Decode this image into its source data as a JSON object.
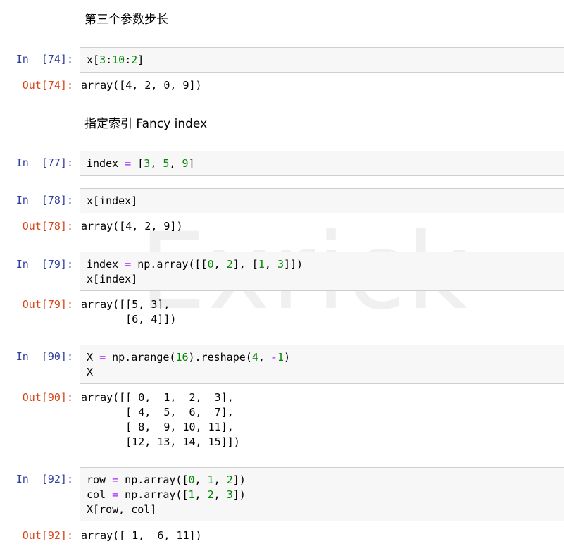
{
  "markdown": {
    "step_heading": "第三个参数步长",
    "fancy_heading": "指定索引 Fancy index"
  },
  "cells": {
    "c74": {
      "in_prompt": "In  [74]:",
      "out_prompt": "Out[74]:",
      "code": "x[3:10:2]",
      "output": "array([4, 2, 0, 9])"
    },
    "c77": {
      "in_prompt": "In  [77]:",
      "code": "index = [3, 5, 9]"
    },
    "c78": {
      "in_prompt": "In  [78]:",
      "out_prompt": "Out[78]:",
      "code": "x[index]",
      "output": "array([4, 2, 9])"
    },
    "c79": {
      "in_prompt": "In  [79]:",
      "out_prompt": "Out[79]:",
      "code": "index = np.array([[0, 2], [1, 3]])\nx[index]",
      "output": "array([[5, 3],\n       [6, 4]])"
    },
    "c90": {
      "in_prompt": "In  [90]:",
      "out_prompt": "Out[90]:",
      "code": "X = np.arange(16).reshape(4, -1)\nX",
      "output": "array([[ 0,  1,  2,  3],\n       [ 4,  5,  6,  7],\n       [ 8,  9, 10, 11],\n       [12, 13, 14, 15]])"
    },
    "c92": {
      "in_prompt": "In  [92]:",
      "out_prompt": "Out[92]:",
      "code": "row = np.array([0, 1, 2])\ncol = np.array([1, 2, 3])\nX[row, col]",
      "output": "array([ 1,  6, 11])"
    }
  },
  "watermark": "Exrick",
  "colors": {
    "in_prompt": "#303f9f",
    "out_prompt": "#d84315",
    "operator": "#aa22ff",
    "number": "#008800",
    "cell_background": "#f7f7f7",
    "cell_border": "#cfcfcf"
  }
}
